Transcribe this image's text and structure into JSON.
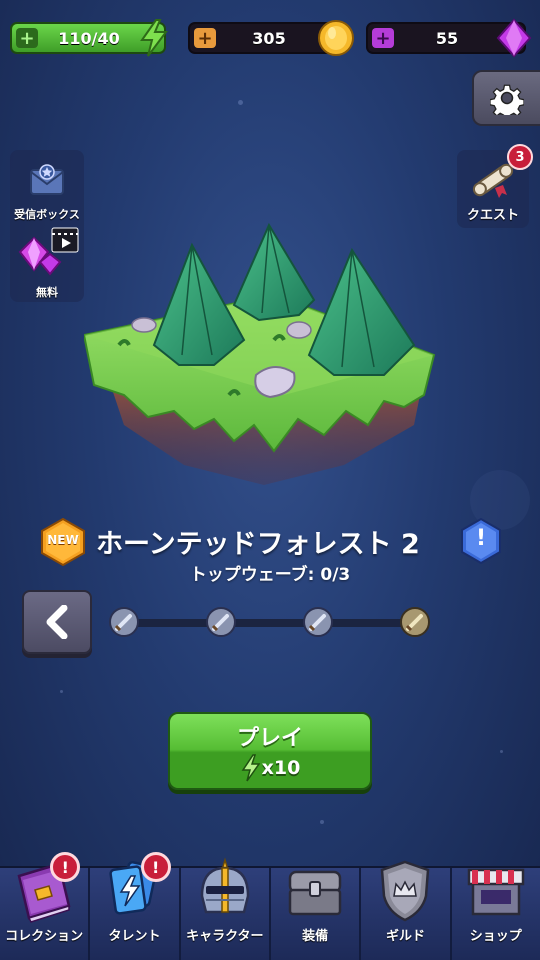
{
  "resources": {
    "energy": "110/40",
    "gold": "305",
    "gems": "55",
    "plus_symbol": "+"
  },
  "left_panel": {
    "inbox_label": "受信ボックス",
    "free_label": "無料"
  },
  "right_panel": {
    "quest_label": "クエスト",
    "quest_badge": "3"
  },
  "level": {
    "new_badge": "NEW",
    "title": "ホーンテッドフォレスト 2",
    "top_wave": "トップウェーブ: 0/3",
    "info_symbol": "!"
  },
  "play": {
    "label": "プレイ",
    "cost": "x10"
  },
  "bottom_nav": {
    "items": [
      {
        "label": "コレクション",
        "alert": "!"
      },
      {
        "label": "タレント",
        "alert": "!"
      },
      {
        "label": "キャラクター"
      },
      {
        "label": "装備"
      },
      {
        "label": "ギルド"
      },
      {
        "label": "ショップ"
      }
    ]
  },
  "colors": {
    "energy_green": "#5cc83c",
    "gold": "#f5b82a",
    "gem_purple": "#c43ae8",
    "background": "#233b70",
    "alert_red": "#c81e3a"
  },
  "icons": [
    "lightning-icon",
    "coin-icon",
    "gem-icon",
    "gear-icon",
    "mailbox-icon",
    "free-gems-video-icon",
    "quest-scroll-icon",
    "new-hexagon-icon",
    "info-hexagon-icon",
    "back-arrow-icon",
    "wave-sword-icon",
    "wave-boss-icon",
    "book-icon",
    "cards-icon",
    "helmet-icon",
    "chest-icon",
    "shield-crown-icon",
    "shop-stall-icon"
  ]
}
